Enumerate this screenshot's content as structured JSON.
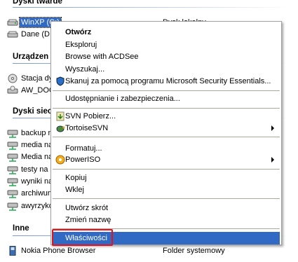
{
  "sections": {
    "hard_disks": "Dyski twarde",
    "removable": "Urządzen",
    "network": "Dyski siec",
    "other": "Inne"
  },
  "items": {
    "winxp": {
      "name": "WinXP (C:)",
      "type": "Dysk lokalny"
    },
    "dane": {
      "name": "Dane (D:)"
    },
    "stacja": {
      "name": "Stacja dy"
    },
    "aw_doc": {
      "name": "AW_DOC"
    },
    "backup": {
      "name": "backup na"
    },
    "media1": {
      "name": "media na"
    },
    "media2": {
      "name": "Media na"
    },
    "testy": {
      "name": "testy na ."
    },
    "wyniki": {
      "name": "wyniki na"
    },
    "archiwum": {
      "name": "archiwum"
    },
    "awyrzyko": {
      "name": "awyrzyko"
    },
    "nokia": {
      "name": "Nokia Phone Browser",
      "type": "Folder systemowy"
    }
  },
  "menu": {
    "open": "Otwórz",
    "explore": "Eksploruj",
    "acdsee": "Browse with ACDSee",
    "search": "Wyszukaj...",
    "scan": "Skanuj za pomocą programu Microsoft Security Essentials...",
    "sharing": "Udostępnianie i zabezpieczenia...",
    "svn_update": "SVN Pobierz...",
    "tortoisesvn": "TortoiseSVN",
    "format": "Formatuj...",
    "poweriso": "PowerISO",
    "copy": "Kopiuj",
    "paste": "Wklej",
    "shortcut": "Utwórz skrót",
    "rename": "Zmień nazwę",
    "properties": "Właściwości"
  },
  "colors": {
    "selection": "#316ac5",
    "highlight_box": "#e8101a"
  }
}
